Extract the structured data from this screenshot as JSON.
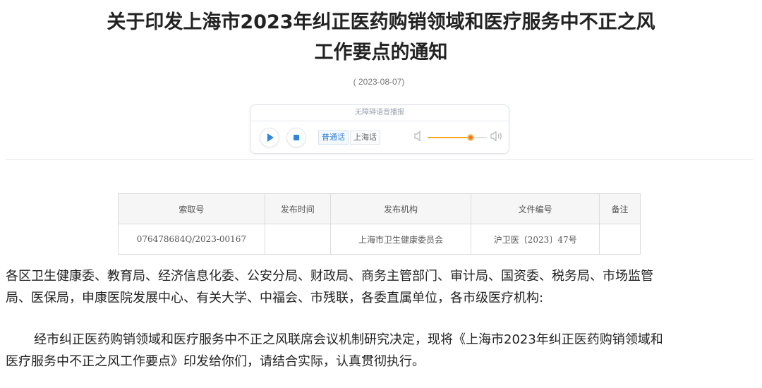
{
  "header": {
    "title_line1": "关于印发上海市2023年纠正医药购销领域和医疗服务中不正之风",
    "title_line2": "工作要点的通知",
    "date": "( 2023-08-07)"
  },
  "player": {
    "label": "无障碍语音播报",
    "languages": [
      "普通话",
      "上海话"
    ],
    "selected_language": "普通话",
    "volume_fraction": 0.73,
    "icons": {
      "play": "play-icon",
      "stop": "stop-icon",
      "vol_low": "volume-low-icon",
      "vol_high": "volume-high-icon"
    },
    "accent_color": "#2e86de",
    "volume_color": "#f5a623"
  },
  "meta_table": {
    "headers": [
      "索取号",
      "发布时间",
      "发布机构",
      "文件编号",
      "备注"
    ],
    "row": [
      "076478684Q/2023-00167",
      "",
      "上海市卫生健康委员会",
      "沪卫医〔2023〕47号",
      ""
    ]
  },
  "body": {
    "p1_line1": "各区卫生健康委、教育局、经济信息化委、公安分局、财政局、商务主管部门、审计局、国资委、税务局、市场监管",
    "p1_line2": "局、医保局，申康医院发展中心、有关大学、中福会、市残联，各委直属单位，各市级医疗机构:",
    "p2_line1": "经市纠正医药购销领域和医疗服务中不正之风联席会议机制研究决定，现将《上海市2023年纠正医药购销领域和",
    "p2_line2": "医疗服务中不正之风工作要点》印发给你们，请结合实际，认真贯彻执行。"
  }
}
